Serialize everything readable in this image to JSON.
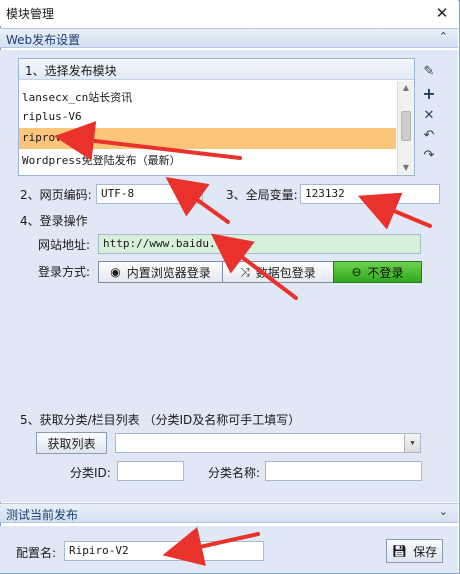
{
  "window": {
    "title": "模块管理"
  },
  "web_group": {
    "title": "Web发布设置"
  },
  "module_list": {
    "header": "1、选择发布模块",
    "items": [
      {
        "label": "lansecx_cn站长资讯",
        "selected": false
      },
      {
        "label": "riplus-V6",
        "selected": false
      },
      {
        "label": "riprov2",
        "selected": true
      },
      {
        "label": "Wordpress免登陆发布（最新）",
        "selected": false
      }
    ]
  },
  "encoding": {
    "label": "2、网页编码:",
    "value": "UTF-8"
  },
  "global_var": {
    "label": "3、全局变量:",
    "value": "123132"
  },
  "login": {
    "section_label": "4、登录操作",
    "url_label": "网站地址:",
    "url_value": "http://www.baidu.com",
    "method_label": "登录方式:",
    "methods": [
      {
        "label": "内置浏览器登录",
        "icon": "globe-icon",
        "active": false
      },
      {
        "label": "数据包登录",
        "icon": "shuffle-icon",
        "active": false
      },
      {
        "label": "不登录",
        "icon": "no-entry-icon",
        "active": true
      }
    ]
  },
  "category": {
    "section_label": "5、获取分类/栏目列表 （分类ID及名称可手工填写）",
    "fetch_button": "获取列表",
    "select_value": "",
    "id_label": "分类ID:",
    "id_value": "",
    "name_label": "分类名称:",
    "name_value": ""
  },
  "test_group": {
    "title": "测试当前发布"
  },
  "config": {
    "label": "配置名:",
    "value": "Ripiro-V2",
    "save_button": "保存"
  },
  "colors": {
    "selected_row": "#fbc57a",
    "active_login": "#3fb52a",
    "group_bg": "#dfe8f4",
    "url_field_bg": "#d7f0d9",
    "annotation_arrow": "#e8322b"
  }
}
